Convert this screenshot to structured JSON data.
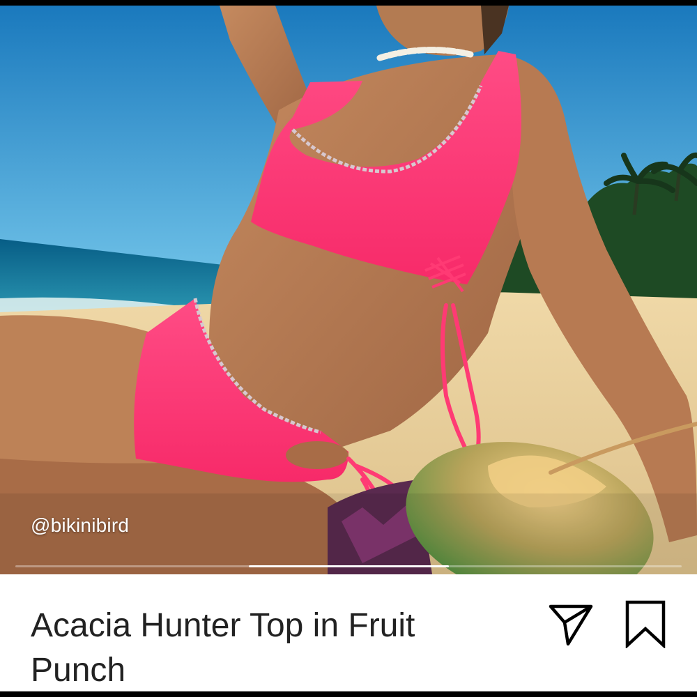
{
  "post": {
    "credit": "@bikinibird",
    "title": "Acacia Hunter Top in Fruit Punch",
    "carousel_position": 0.5
  },
  "actions": {
    "share_icon": "send-icon",
    "save_icon": "bookmark-icon"
  },
  "colors": {
    "sky": "#1f86c8",
    "ocean": "#0a6d94",
    "sand": "#e9cf9b",
    "swimsuit": "#ff3b77",
    "text": "#222222",
    "background": "#ffffff"
  }
}
